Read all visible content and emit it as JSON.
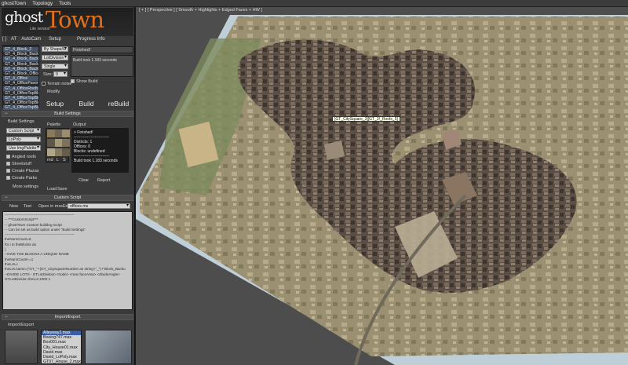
{
  "menu": {
    "items": [
      "ghostTown",
      "Topology",
      "Tools"
    ]
  },
  "logo": {
    "ghost": "ghost",
    "town": "Town",
    "sub": "Lite version"
  },
  "panel": {
    "tabs": [
      "[ ]",
      "AT",
      "AutoCam",
      "Setup",
      "Progress Info"
    ],
    "objects": [
      "GT_4_Block_2",
      "GT_4_Block_Backuti",
      "GT_4_Block_Backuti",
      "GT_4_Block_Backuti",
      "GT_4_Block_Backuti",
      "GT_4_Block_Office",
      "GT_4_Office",
      "GT_4_OfficePavem",
      "GT_4_OfficeRoofs",
      "GT_4_OfficeTopBlo",
      "GT_4_OfficeTopBlo",
      "GT_4_OfficeTopBlo",
      "GT_4_OfficeTopBlo"
    ],
    "setup": {
      "shape": "By Shape/G",
      "lot": "LotDivision",
      "single": "Single",
      "size_label": "Size:",
      "size_value": "0",
      "terrain_label": "Terrain noise",
      "modify_label": "Modify"
    },
    "progress": {
      "status": "Finished!",
      "message": "Build took 1.183 seconds",
      "show_build": "Show Build"
    },
    "buttons": {
      "setup": "Setup",
      "build": "Build",
      "rebuild": "reBuild"
    }
  },
  "build_settings": {
    "title": "Build Settings",
    "label": "Build Settings",
    "script": "Custom Script",
    "poly": "LoPoly",
    "image": "Use ImgPalette",
    "checks": [
      {
        "label": "Angled roofs",
        "on": true
      },
      {
        "label": "Streetstuff",
        "on": true
      },
      {
        "label": "Create Plazas",
        "on": true
      },
      {
        "label": "Create Parks",
        "on": true
      }
    ],
    "more": "More settings",
    "palette_label": "Palette",
    "palette_bottom": [
      "md",
      "L",
      "S"
    ],
    "palette_load": "Load",
    "palette_save": "Save",
    "output_label": "Output",
    "output_lines": [
      "> Finished!",
      "---------------------------",
      "Districts: 1",
      "Offices: 0",
      "Blocks: undefined",
      "---------------------------",
      "Build took 1.183 seconds"
    ],
    "clear": "Clear",
    "report": "Report",
    "palette_colors": [
      "#8a7a5c",
      "#6f6452",
      "#9b8e70",
      "#5e5646",
      "#a39979",
      "#7d725c",
      "#b0a688",
      "#857b63",
      "#675d4b"
    ]
  },
  "custom_script": {
    "title": "Custom Script",
    "buttons": [
      "New",
      "Test",
      "Open in mxsEd"
    ],
    "file": "offices.ms",
    "lines": [
      "----------------------------------------------------------",
      "-- ***CustomScript***",
      "-- ghostTown Custom building script",
      "",
      "-- Can be set as build option under \"Build Settings\"",
      "",
      "----------------------------------------------------------",
      "",
      "theNumCount=6",
      "",
      "for i in theBlocks do",
      "(",
      "--GIVE THE BLOCKS A UNIQUE NAME",
      "theNumCount+=1",
      "theLot=i",
      "theLot.name=(\"GT_\"+(GT_CitySquareNumber as string+\"_\")+\"Block_Backu",
      "",
      "",
      "--DIVIDE LOTS - GTLotDivision <node> <max faceArea> <divideAngle>",
      "GTLotDivision theLot 1000 1"
    ]
  },
  "import_export": {
    "title": "Import/Export",
    "label": "Import/Export",
    "files": [
      "Alleyway2.max",
      "Boeing747.max",
      "Box001.max",
      "City_House01.max",
      "David.max",
      "David_LoPoly.max",
      "GT07_House_2.max"
    ]
  },
  "viewport": {
    "label": "[ + ] [ Perspective ] [ Smooth + Highlights + Edged Faces + HW ]",
    "tooltip": "[GT_CitySquare_3][GT_3!_Roofs_5]"
  }
}
